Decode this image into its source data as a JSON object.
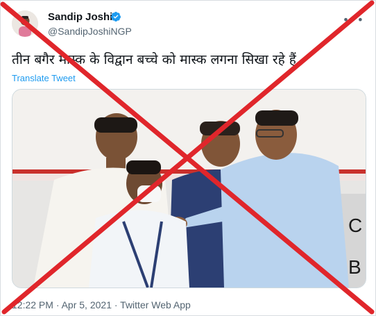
{
  "tweet": {
    "author": {
      "name": "Sandip Joshi",
      "handle": "@SandipJoshiNGP",
      "avatar_icon": "profile-photo"
    },
    "verified_icon": "verified-badge-icon",
    "more_icon": "more-options-icon",
    "text": "तीन बगैर मास्क के विद्वान बच्चे को मास्क लगना सिखा रहे हैं.",
    "translate_label": "Translate Tweet",
    "timestamp": "12:22 PM · Apr 5, 2021 · Twitter Web App"
  },
  "colors": {
    "link_blue": "#1d9bf0",
    "verified_blue": "#1d9bf0",
    "text_primary": "#0f1419",
    "text_secondary": "#536471",
    "cross_red": "#e0262b"
  },
  "overlay": {
    "type": "red-cross",
    "meaning": "fake / debunked mark"
  }
}
